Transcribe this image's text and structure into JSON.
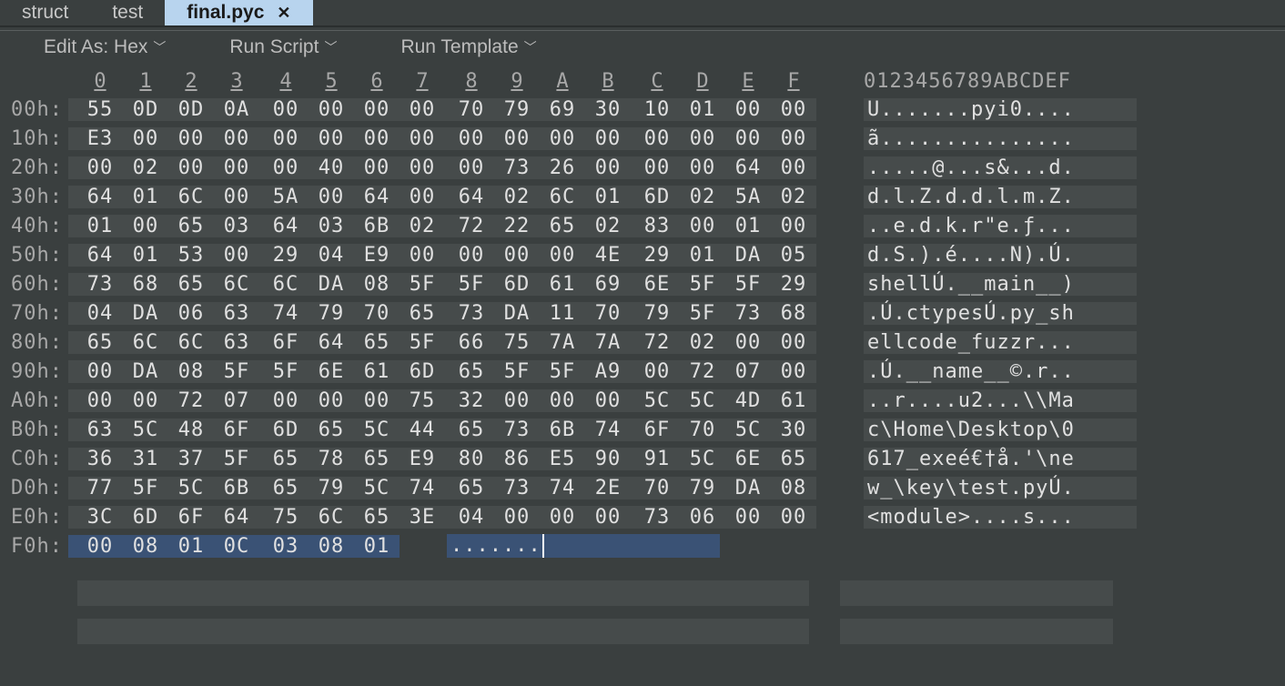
{
  "tabs": [
    {
      "label": "struct",
      "active": false
    },
    {
      "label": "test",
      "active": false
    },
    {
      "label": "final.pyc",
      "active": true
    }
  ],
  "toolbar": {
    "edit_as": "Edit As: Hex",
    "run_script": "Run Script",
    "run_template": "Run Template"
  },
  "hex": {
    "col_labels": [
      "0",
      "1",
      "2",
      "3",
      "4",
      "5",
      "6",
      "7",
      "8",
      "9",
      "A",
      "B",
      "C",
      "D",
      "E",
      "F"
    ],
    "ascii_header": "0123456789ABCDEF",
    "rows": [
      {
        "addr": "00h:",
        "bytes": [
          "55",
          "0D",
          "0D",
          "0A",
          "00",
          "00",
          "00",
          "00",
          "70",
          "79",
          "69",
          "30",
          "10",
          "01",
          "00",
          "00"
        ],
        "ascii": "U.......pyi0...."
      },
      {
        "addr": "10h:",
        "bytes": [
          "E3",
          "00",
          "00",
          "00",
          "00",
          "00",
          "00",
          "00",
          "00",
          "00",
          "00",
          "00",
          "00",
          "00",
          "00",
          "00"
        ],
        "ascii": "ã..............."
      },
      {
        "addr": "20h:",
        "bytes": [
          "00",
          "02",
          "00",
          "00",
          "00",
          "40",
          "00",
          "00",
          "00",
          "73",
          "26",
          "00",
          "00",
          "00",
          "64",
          "00"
        ],
        "ascii": ".....@...s&...d."
      },
      {
        "addr": "30h:",
        "bytes": [
          "64",
          "01",
          "6C",
          "00",
          "5A",
          "00",
          "64",
          "00",
          "64",
          "02",
          "6C",
          "01",
          "6D",
          "02",
          "5A",
          "02"
        ],
        "ascii": "d.l.Z.d.d.l.m.Z."
      },
      {
        "addr": "40h:",
        "bytes": [
          "01",
          "00",
          "65",
          "03",
          "64",
          "03",
          "6B",
          "02",
          "72",
          "22",
          "65",
          "02",
          "83",
          "00",
          "01",
          "00"
        ],
        "ascii": "..e.d.k.r\"e.ƒ..."
      },
      {
        "addr": "50h:",
        "bytes": [
          "64",
          "01",
          "53",
          "00",
          "29",
          "04",
          "E9",
          "00",
          "00",
          "00",
          "00",
          "4E",
          "29",
          "01",
          "DA",
          "05"
        ],
        "ascii": "d.S.).é....N).Ú."
      },
      {
        "addr": "60h:",
        "bytes": [
          "73",
          "68",
          "65",
          "6C",
          "6C",
          "DA",
          "08",
          "5F",
          "5F",
          "6D",
          "61",
          "69",
          "6E",
          "5F",
          "5F",
          "29"
        ],
        "ascii": "shellÚ.__main__)"
      },
      {
        "addr": "70h:",
        "bytes": [
          "04",
          "DA",
          "06",
          "63",
          "74",
          "79",
          "70",
          "65",
          "73",
          "DA",
          "11",
          "70",
          "79",
          "5F",
          "73",
          "68"
        ],
        "ascii": ".Ú.ctypesÚ.py_sh"
      },
      {
        "addr": "80h:",
        "bytes": [
          "65",
          "6C",
          "6C",
          "63",
          "6F",
          "64",
          "65",
          "5F",
          "66",
          "75",
          "7A",
          "7A",
          "72",
          "02",
          "00",
          "00"
        ],
        "ascii": "ellcode_fuzzr..."
      },
      {
        "addr": "90h:",
        "bytes": [
          "00",
          "DA",
          "08",
          "5F",
          "5F",
          "6E",
          "61",
          "6D",
          "65",
          "5F",
          "5F",
          "A9",
          "00",
          "72",
          "07",
          "00"
        ],
        "ascii": ".Ú.__name__©.r.."
      },
      {
        "addr": "A0h:",
        "bytes": [
          "00",
          "00",
          "72",
          "07",
          "00",
          "00",
          "00",
          "75",
          "32",
          "00",
          "00",
          "00",
          "5C",
          "5C",
          "4D",
          "61"
        ],
        "ascii": "..r....u2...\\\\Ma"
      },
      {
        "addr": "B0h:",
        "bytes": [
          "63",
          "5C",
          "48",
          "6F",
          "6D",
          "65",
          "5C",
          "44",
          "65",
          "73",
          "6B",
          "74",
          "6F",
          "70",
          "5C",
          "30"
        ],
        "ascii": "c\\Home\\Desktop\\0"
      },
      {
        "addr": "C0h:",
        "bytes": [
          "36",
          "31",
          "37",
          "5F",
          "65",
          "78",
          "65",
          "E9",
          "80",
          "86",
          "E5",
          "90",
          "91",
          "5C",
          "6E",
          "65"
        ],
        "ascii": "617_exeé€†å.'\\ne"
      },
      {
        "addr": "D0h:",
        "bytes": [
          "77",
          "5F",
          "5C",
          "6B",
          "65",
          "79",
          "5C",
          "74",
          "65",
          "73",
          "74",
          "2E",
          "70",
          "79",
          "DA",
          "08"
        ],
        "ascii": "w_\\key\\test.pyÚ."
      },
      {
        "addr": "E0h:",
        "bytes": [
          "3C",
          "6D",
          "6F",
          "64",
          "75",
          "6C",
          "65",
          "3E",
          "04",
          "00",
          "00",
          "00",
          "73",
          "06",
          "00",
          "00"
        ],
        "ascii": "<module>....s..."
      },
      {
        "addr": "F0h:",
        "bytes": [
          "00",
          "08",
          "01",
          "0C",
          "03",
          "08",
          "01"
        ],
        "ascii": ".......",
        "last": true
      }
    ]
  }
}
